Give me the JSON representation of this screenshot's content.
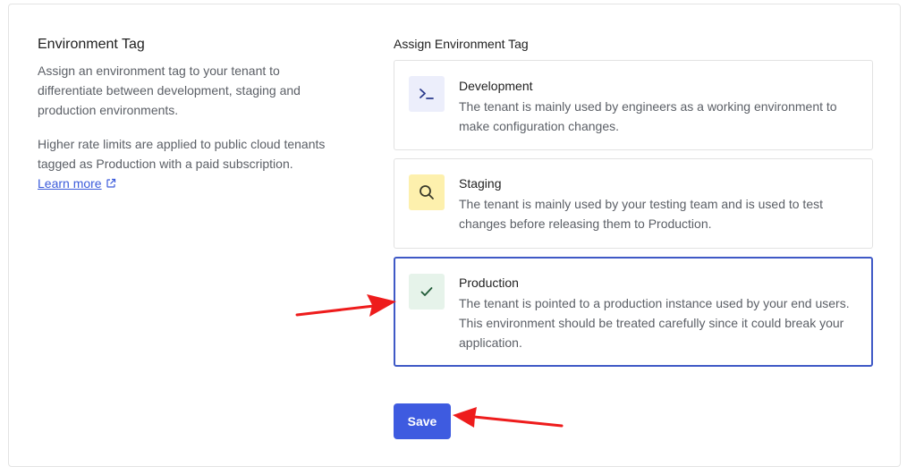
{
  "info": {
    "title": "Environment Tag",
    "desc1": "Assign an environment tag to your tenant to differentiate between development, staging and production environments.",
    "desc2": "Higher rate limits are applied to public cloud tenants tagged as Production with a paid subscription.",
    "learn_more": "Learn more"
  },
  "assign_label": "Assign Environment Tag",
  "options": [
    {
      "title": "Development",
      "description": "The tenant is mainly used by engineers as a working environment to make configuration changes.",
      "icon": "terminal-icon",
      "icon_bg": "#eceefb",
      "selected": false
    },
    {
      "title": "Staging",
      "description": "The tenant is mainly used by your testing team and is used to test changes before releasing them to Production.",
      "icon": "search-icon",
      "icon_bg": "#fdf0ad",
      "selected": false
    },
    {
      "title": "Production",
      "description": "The tenant is pointed to a production instance used by your end users. This environment should be treated carefully since it could break your application.",
      "icon": "check-icon",
      "icon_bg": "#e6f3ea",
      "selected": true
    }
  ],
  "save_label": "Save",
  "colors": {
    "accent": "#3e5be0",
    "selected_border": "#3f59c6",
    "annotation_arrow": "#ee1c1c"
  }
}
